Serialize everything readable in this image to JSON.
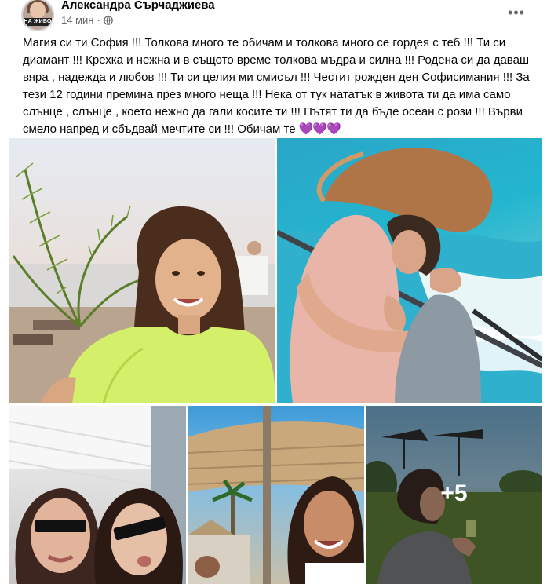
{
  "post": {
    "author": "Александра Сърчаджиева",
    "time": "14 мин",
    "separator": "·",
    "privacy_icon": "globe-icon",
    "more_icon": "more-options-icon",
    "more_label": "•••",
    "avatar_tag": "НА ЖИВО",
    "text": "Магия си ти София !!! Толкова много те обичам и толкова много се гордея с теб !!! Ти си диамант !!! Крехка и нежна и в същото време толкова мъдра и силна !!! Родена си да даваш вяра , надежда и любов !!! Ти си целия ми смисъл !!! Честит рожден ден Софисимания !!! За тези 12 години премина през много неща !!! Нека от тук нататък в живота ти да има само слънце , слънце , което нежно да гали косите ти !!! Пътят ти да бъде оcеан с рози !!! Върви смело напред и сбъдвай мечтите си !!! Обичам те",
    "text_emoji": "💜💜💜"
  },
  "photos": {
    "count_overlay": "+5",
    "items": [
      {
        "name": "photo-girl-palm-beach"
      },
      {
        "name": "photo-mother-hugging-daughter-sea"
      },
      {
        "name": "photo-selfie-sunglasses"
      },
      {
        "name": "photo-beach-umbrella-selfie"
      },
      {
        "name": "photo-boy-garden"
      }
    ]
  },
  "colors": {
    "text": "#050505",
    "secondary_text": "#65676b",
    "heart": "#8b3dd6"
  }
}
